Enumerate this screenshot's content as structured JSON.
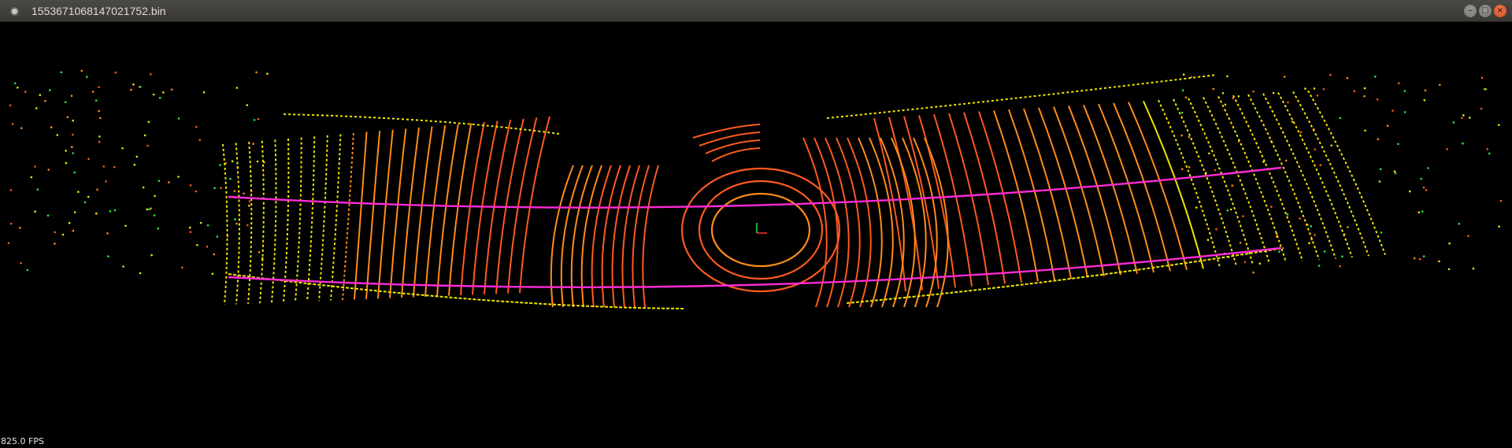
{
  "window": {
    "title": "1553671068147021752.bin",
    "controls": {
      "minimize_icon": "–",
      "maximize_icon": "□",
      "close_icon": "×"
    }
  },
  "status": {
    "fps": "825.0 FPS"
  },
  "colors": {
    "background": "#000000",
    "lane_line": "#ff2bd6",
    "point_near": "#ff5a1e",
    "point_mid": "#ff8c1a",
    "point_far": "#f2e600",
    "point_sparse": "#2ee84a",
    "axis_x": "#ff3030",
    "axis_y": "#30e040"
  },
  "icons": {
    "app": "app-icon",
    "axes": "origin-axes-icon"
  }
}
